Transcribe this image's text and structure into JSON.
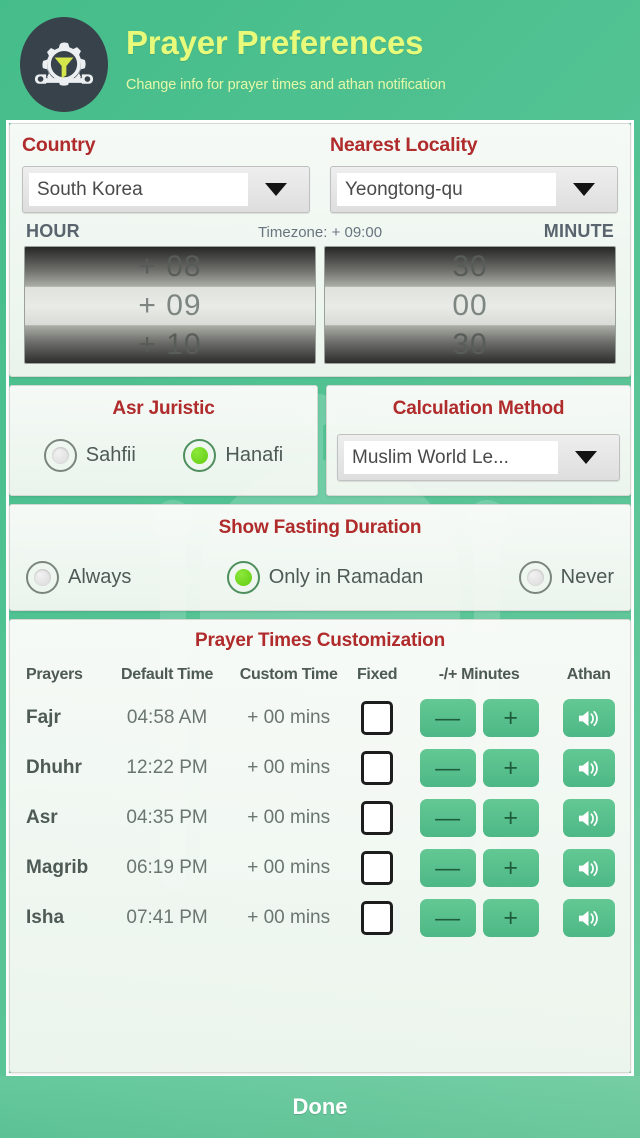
{
  "header": {
    "icon": "gear-funnel-wrench-icon",
    "title": "Prayer Preferences",
    "subtitle": "Change info for prayer times and athan notification",
    "title_color": "#e8fa7a"
  },
  "location": {
    "country_label": "Country",
    "country_value": "South Korea",
    "locality_label": "Nearest Locality",
    "locality_value": "Yeongtong-qu",
    "dropdown_icon": "chevron-down-icon"
  },
  "timezone": {
    "hour_label": "HOUR",
    "minute_label": "MINUTE",
    "summary": "Timezone: + 09:00",
    "hour_prev": "+ 08",
    "hour_current": "+ 09",
    "hour_next": "+ 10",
    "minute_prev": "30",
    "minute_current": "00",
    "minute_next": "30"
  },
  "asr": {
    "title": "Asr Juristic",
    "options": [
      {
        "label": "Sahfii",
        "selected": false
      },
      {
        "label": "Hanafi",
        "selected": true
      }
    ]
  },
  "calculation": {
    "title": "Calculation Method",
    "value": "Muslim World Le..."
  },
  "fasting": {
    "title": "Show Fasting Duration",
    "options": [
      {
        "label": "Always",
        "selected": false
      },
      {
        "label": "Only in Ramadan",
        "selected": true
      },
      {
        "label": "Never",
        "selected": false
      }
    ]
  },
  "prayer_table": {
    "title": "Prayer Times Customization",
    "columns": [
      "Prayers",
      "Default Time",
      "Custom Time",
      "Fixed",
      "-/+ Minutes",
      "Athan"
    ],
    "minus_label": "—",
    "plus_label": "+",
    "athan_icon": "speaker-icon",
    "rows": [
      {
        "prayer": "Fajr",
        "default_time": "04:58 AM",
        "custom_time": "+ 00 mins",
        "fixed": false
      },
      {
        "prayer": "Dhuhr",
        "default_time": "12:22 PM",
        "custom_time": "+ 00 mins",
        "fixed": false
      },
      {
        "prayer": "Asr",
        "default_time": "04:35 PM",
        "custom_time": "+ 00 mins",
        "fixed": false
      },
      {
        "prayer": "Magrib",
        "default_time": "06:19 PM",
        "custom_time": "+ 00 mins",
        "fixed": false
      },
      {
        "prayer": "Isha",
        "default_time": "07:41 PM",
        "custom_time": "+ 00 mins",
        "fixed": false
      }
    ]
  },
  "footer": {
    "done_label": "Done"
  },
  "colors": {
    "background_green": "#52c293",
    "accent_red": "#b02b2b",
    "button_green": "#4db886",
    "radio_green": "#62cc12"
  }
}
